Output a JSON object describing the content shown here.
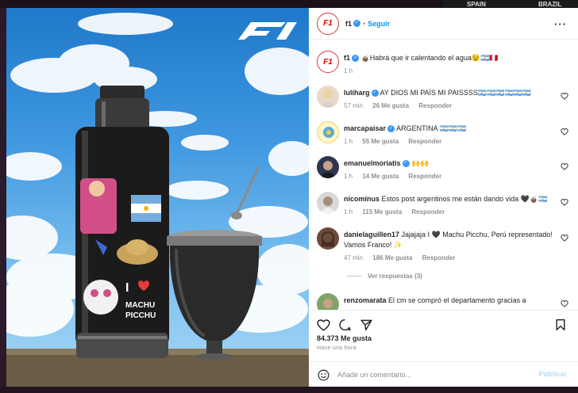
{
  "background": {
    "top_right_labels": [
      "SPAIN",
      "BRAZIL"
    ]
  },
  "post": {
    "author": "f1",
    "follow_label": "Seguir",
    "caption": "🧉Habrá que ir calentando el agua😉🇦🇷🇵🇪",
    "caption_time": "1 h",
    "image": {
      "stickers": [
        "I",
        "MACHU",
        "PICCHU"
      ],
      "logo": "F1"
    }
  },
  "comments": [
    {
      "user": "luliharg",
      "verified": true,
      "text": "AY DIOS MI PAÍS MI PAISSSS🇦🇷🇦🇷🇦🇷🇦🇷🇦🇷🇦🇷",
      "time": "57 min",
      "likes": "26 Me gusta",
      "reply": "Responder"
    },
    {
      "user": "marcapaisar",
      "verified": true,
      "text": "ARGENTINA 🇦🇷🇦🇷🇦🇷",
      "time": "1 h",
      "likes": "55 Me gusta",
      "reply": "Responder"
    },
    {
      "user": "emanuelmoriatis",
      "verified": true,
      "text": "🙌🙌",
      "time": "1 h",
      "likes": "14 Me gusta",
      "reply": "Responder"
    },
    {
      "user": "nicominus",
      "verified": false,
      "text": "Estos post argentinos me están dando vida 🖤🧉🇦🇷",
      "time": "1 h",
      "likes": "115 Me gusta",
      "reply": "Responder"
    },
    {
      "user": "danielaguillen17",
      "verified": false,
      "text": "Jajajaja I 🖤 Machu Picchu, Perú representado! Vamos Franco! ✨",
      "time": "47 min",
      "likes": "186 Me gusta",
      "reply": "Responder",
      "view_replies": "Ver respuestas (3)"
    },
    {
      "user": "renzomarata",
      "verified": false,
      "text": "El cm se compró el departamento gracias a",
      "time": "",
      "likes": "",
      "reply": ""
    }
  ],
  "stats": {
    "likes": "84.373 Me gusta",
    "ago": "Hace una hora"
  },
  "add_comment": {
    "placeholder": "Añade un comentario...",
    "publish": "Publicar"
  },
  "icons": {
    "like": "heart-icon",
    "comment": "comment-icon",
    "share": "share-icon",
    "save": "bookmark-icon",
    "more": "more-options-icon",
    "emoji": "emoji-icon"
  },
  "colors": {
    "brand_red": "#e10600",
    "link_blue": "#0095f6",
    "verified_blue": "#3897f0",
    "muted": "#8e8e8e"
  }
}
